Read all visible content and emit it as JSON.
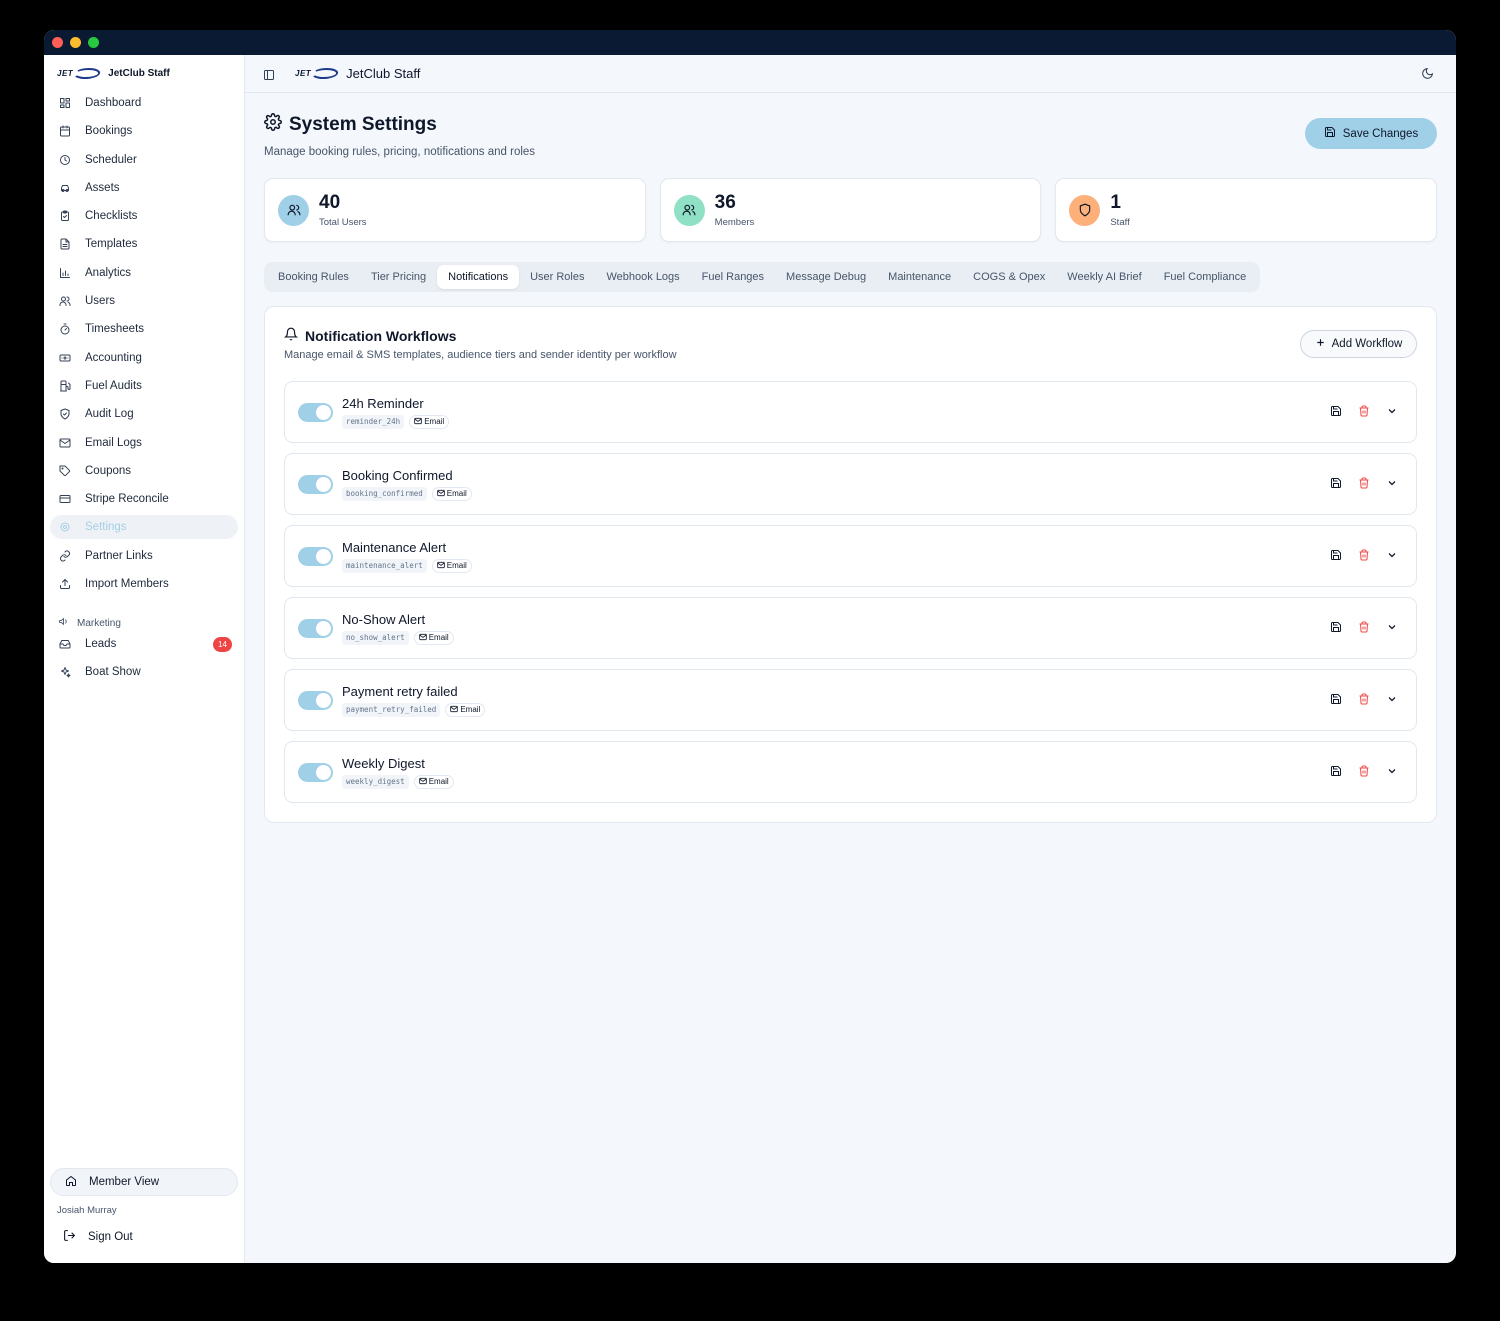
{
  "app": {
    "brand_name": "JetClub Staff",
    "logo_word": "JET"
  },
  "sidebar": {
    "items": [
      {
        "label": "Dashboard",
        "icon": "dashboard-icon"
      },
      {
        "label": "Bookings",
        "icon": "calendar-icon"
      },
      {
        "label": "Scheduler",
        "icon": "clock-icon"
      },
      {
        "label": "Assets",
        "icon": "car-icon"
      },
      {
        "label": "Checklists",
        "icon": "clipboard-icon"
      },
      {
        "label": "Templates",
        "icon": "file-text-icon"
      },
      {
        "label": "Analytics",
        "icon": "bar-chart-icon"
      },
      {
        "label": "Users",
        "icon": "users-icon"
      },
      {
        "label": "Timesheets",
        "icon": "timer-icon"
      },
      {
        "label": "Accounting",
        "icon": "banknote-icon"
      },
      {
        "label": "Fuel Audits",
        "icon": "fuel-icon"
      },
      {
        "label": "Audit Log",
        "icon": "shield-icon"
      },
      {
        "label": "Email Logs",
        "icon": "mail-icon"
      },
      {
        "label": "Coupons",
        "icon": "tag-icon"
      },
      {
        "label": "Stripe Reconcile",
        "icon": "credit-card-icon"
      },
      {
        "label": "Settings",
        "icon": "gear-icon",
        "active": true
      },
      {
        "label": "Partner Links",
        "icon": "link-icon"
      },
      {
        "label": "Import Members",
        "icon": "upload-icon"
      }
    ],
    "marketing_label": "Marketing",
    "marketing_items": [
      {
        "label": "Leads",
        "icon": "inbox-icon",
        "badge": "14"
      },
      {
        "label": "Boat Show",
        "icon": "sparkles-icon"
      }
    ],
    "member_view": "Member View",
    "user_name": "Josiah Murray",
    "sign_out": "Sign Out"
  },
  "topbar": {
    "title": "JetClub Staff"
  },
  "page": {
    "title": "System Settings",
    "subtitle": "Manage booking rules, pricing, notifications and roles",
    "save_label": "Save Changes"
  },
  "stats": [
    {
      "value": "40",
      "label": "Total Users",
      "color": "#9fd0e8"
    },
    {
      "value": "36",
      "label": "Members",
      "color": "#8fe0c4"
    },
    {
      "value": "1",
      "label": "Staff",
      "color": "#fdb07a"
    }
  ],
  "tabs": [
    "Booking Rules",
    "Tier Pricing",
    "Notifications",
    "User Roles",
    "Webhook Logs",
    "Fuel Ranges",
    "Message Debug",
    "Maintenance",
    "COGS & Opex",
    "Weekly AI Brief",
    "Fuel Compliance"
  ],
  "active_tab": "Notifications",
  "panel": {
    "title": "Notification Workflows",
    "subtitle": "Manage email & SMS templates, audience tiers and sender identity per workflow",
    "add_label": "Add Workflow"
  },
  "workflows": [
    {
      "name": "24h Reminder",
      "key": "reminder_24h",
      "channel": "Email",
      "enabled": true
    },
    {
      "name": "Booking Confirmed",
      "key": "booking_confirmed",
      "channel": "Email",
      "enabled": true
    },
    {
      "name": "Maintenance Alert",
      "key": "maintenance_alert",
      "channel": "Email",
      "enabled": true
    },
    {
      "name": "No-Show Alert",
      "key": "no_show_alert",
      "channel": "Email",
      "enabled": true
    },
    {
      "name": "Payment retry failed",
      "key": "payment_retry_failed",
      "channel": "Email",
      "enabled": true
    },
    {
      "name": "Weekly Digest",
      "key": "weekly_digest",
      "channel": "Email",
      "enabled": true
    }
  ],
  "colors": {
    "accent": "#9fd0e8",
    "danger": "#ef4444",
    "titlebar": "#0b1a33"
  }
}
